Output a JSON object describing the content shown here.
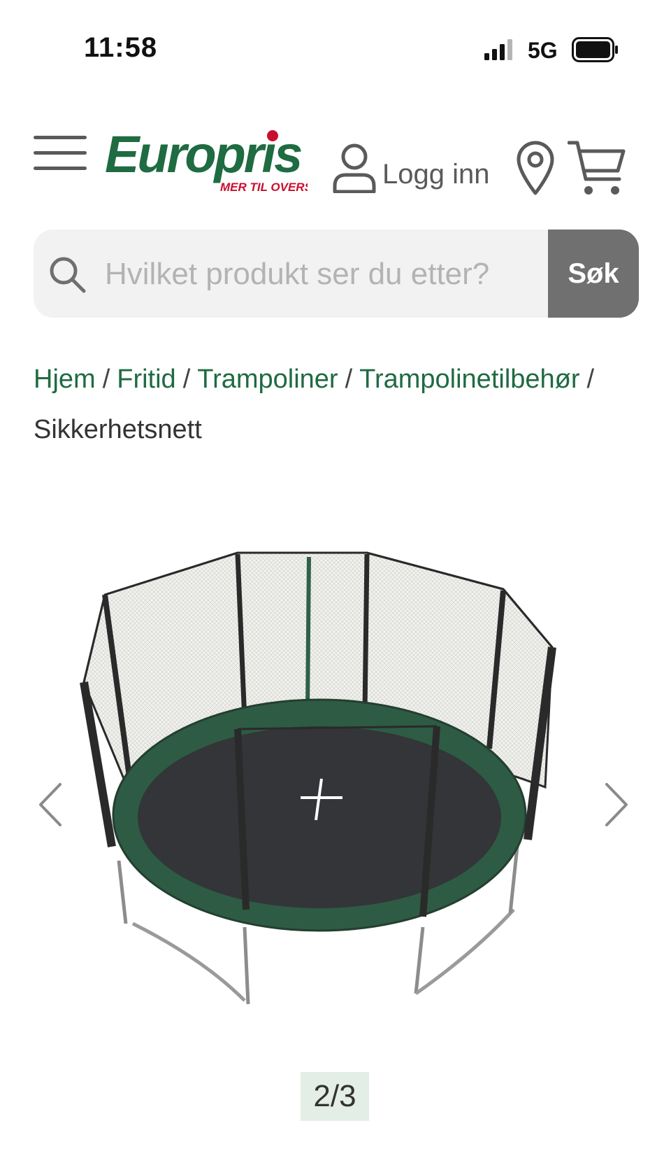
{
  "status_bar": {
    "time": "11:58",
    "network": "5G"
  },
  "header": {
    "logo": {
      "brand": "Europris",
      "tagline": "MER TIL OVERS"
    },
    "login_label": "Logg inn"
  },
  "search": {
    "placeholder": "Hvilket produkt ser du etter?",
    "button_label": "Søk"
  },
  "breadcrumb": {
    "items": [
      "Hjem",
      "Fritid",
      "Trampoliner",
      "Trampolinetilbehør"
    ],
    "current": "Sikkerhetsnett",
    "separator": "/"
  },
  "gallery": {
    "counter": "2/3"
  },
  "colors": {
    "brand_green": "#1f6b42",
    "brand_red": "#c8102e",
    "search_button": "#707070",
    "counter_bg": "#e3eee6"
  }
}
